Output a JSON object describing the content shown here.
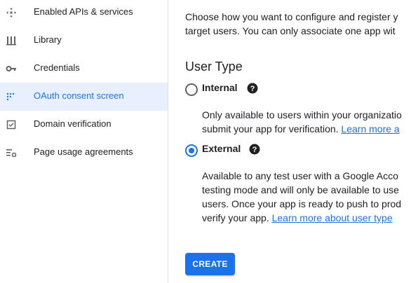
{
  "sidebar": {
    "items": [
      {
        "label": "Enabled APIs & services",
        "icon": "apis-services-icon",
        "active": false
      },
      {
        "label": "Library",
        "icon": "library-icon",
        "active": false
      },
      {
        "label": "Credentials",
        "icon": "key-icon",
        "active": false
      },
      {
        "label": "OAuth consent screen",
        "icon": "consent-screen-icon",
        "active": true
      },
      {
        "label": "Domain verification",
        "icon": "checkbox-icon",
        "active": false
      },
      {
        "label": "Page usage agreements",
        "icon": "settings-list-icon",
        "active": false
      }
    ]
  },
  "main": {
    "intro_lines": [
      "Choose how you want to configure and register y",
      "target users. You can only associate one app wit"
    ],
    "section_title": "User Type",
    "options": [
      {
        "label": "Internal",
        "checked": false,
        "desc_lines": [
          "Only available to users within your organizatio",
          "submit your app for verification. "
        ],
        "link": "Learn more a"
      },
      {
        "label": "External",
        "checked": true,
        "desc_lines": [
          "Available to any test user with a Google Acco",
          "testing mode and will only be available to use",
          "users. Once your app is ready to push to prod",
          "verify your app. "
        ],
        "link": "Learn more about user type"
      }
    ],
    "create_label": "CREATE"
  },
  "colors": {
    "accent": "#1a73e8",
    "active_bg": "#e8f0fe",
    "text": "#202124",
    "icon": "#5f6368"
  }
}
